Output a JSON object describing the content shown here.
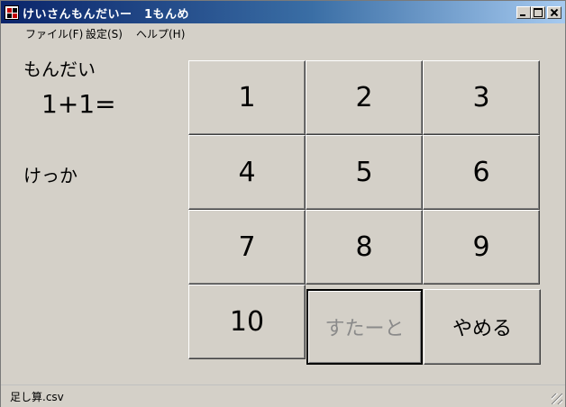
{
  "window": {
    "title": "けいさんもんだいー　1もんめ"
  },
  "menu": {
    "items": [
      {
        "label": "ファイル(F)"
      },
      {
        "label": "設定(S)"
      },
      {
        "label": "ヘルプ(H)"
      }
    ]
  },
  "main": {
    "mondai_label": "もんだい",
    "problem": "1+1=",
    "kekka_label": "けっか"
  },
  "buttons": {
    "numbers": [
      "1",
      "2",
      "3",
      "4",
      "5",
      "6",
      "7",
      "8",
      "9",
      "10"
    ],
    "start_label": "すたーと",
    "stop_label": "やめる"
  },
  "status": {
    "file": "足し算.csv"
  },
  "icons": {
    "window_controls": [
      "minimize-icon",
      "maximize-icon",
      "close-icon"
    ]
  }
}
